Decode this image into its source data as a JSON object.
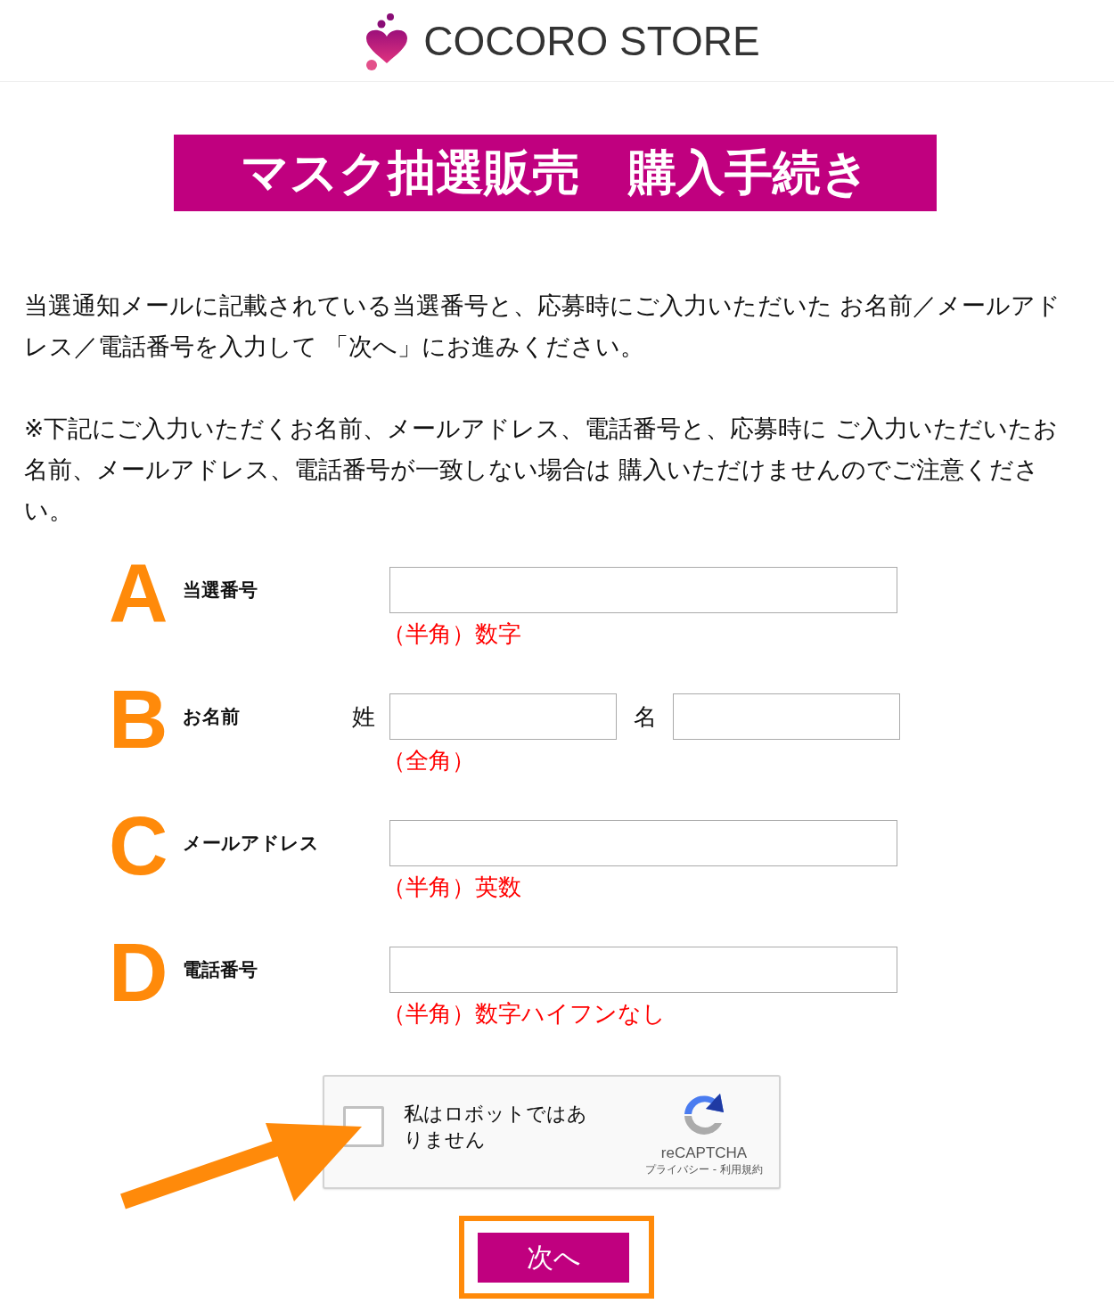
{
  "header": {
    "logo_text": "COCORO STORE"
  },
  "title": "マスク抽選販売　購入手続き",
  "paragraphs": [
    "当選通知メールに記載されている当選番号と、応募時にご入力いただいた お名前／メールアドレス／電話番号を入力して 「次へ」にお進みください。",
    "※下記にご入力いただくお名前、メールアドレス、電話番号と、応募時に ご入力いただいたお名前、メールアドレス、電話番号が一致しない場合は 購入いただけませんのでご注意ください。"
  ],
  "form": {
    "rows": [
      {
        "letter": "A",
        "label": "当選番号",
        "kind": "single",
        "note": "（半角）数字"
      },
      {
        "letter": "B",
        "label": "お名前",
        "kind": "name",
        "parts": [
          "姓",
          "名"
        ],
        "note": "（全角）"
      },
      {
        "letter": "C",
        "label": "メールアドレス",
        "kind": "single",
        "note": "（半角）英数"
      },
      {
        "letter": "D",
        "label": "電話番号",
        "kind": "single",
        "note": "（半角）数字ハイフンなし"
      }
    ]
  },
  "captcha": {
    "label": "私はロボットではありません",
    "checked": false,
    "brand": "reCAPTCHA",
    "links": "プライバシー - 利用規約"
  },
  "submit_button": {
    "label": "次へ"
  }
}
